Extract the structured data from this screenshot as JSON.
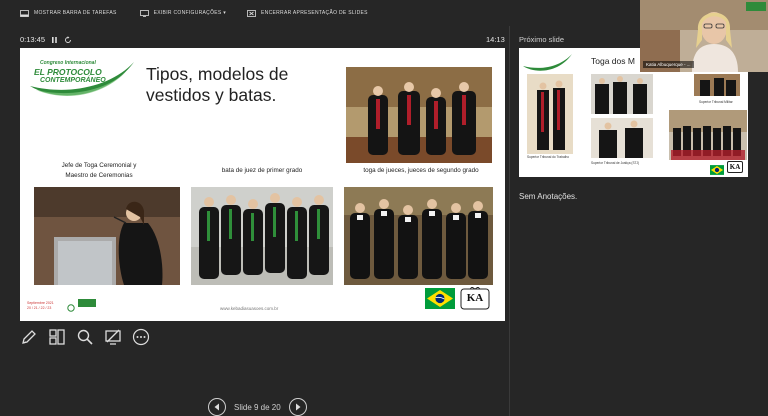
{
  "toolbar": {
    "show_taskbar": "MOSTRAR BARRA DE TAREFAS",
    "display_settings": "EXIBIR CONFIGURAÇÕES ▾",
    "end_show": "ENCERRAR APRESENTAÇÃO DE SLIDES"
  },
  "presenter": {
    "elapsed": "0:13:45",
    "clock": "14:13",
    "next_slide_label": "Próximo slide",
    "notes": "Sem Anotações.",
    "slide_counter": "Slide 9 de 20"
  },
  "slide": {
    "logo_line1": "Congreso Internacional",
    "logo_line2": "EL PROTOCOLO",
    "logo_line3": "CONTEMPORÁNEO",
    "title_line1": "Tipos, modelos de",
    "title_line2": "vestidos y batas.",
    "caption_1_line1": "Jefe de Toga Ceremonial y",
    "caption_1_line2": "Maestro de Ceremonias",
    "caption_2": "bata de juez de primer grado",
    "caption_3": "toga de jueces, jueces de segundo grado",
    "date_line1": "Septiembre 2021",
    "date_line2": "20 / 21 / 22 / 23",
    "website": "www.kebadiasuasoes.com.br",
    "ka_logo": "KA"
  },
  "next_slide": {
    "title": "Toga dos M",
    "cap_a": "Superior Tribunal do Trabalho",
    "cap_b": "Superior Tribunal de Justiça",
    "cap_b2": "(STJ)",
    "cap_c": "Superior Tribunal Militar",
    "ka_logo": "KA"
  },
  "video": {
    "name": "Katia Albuquerque - ..."
  },
  "colors": {
    "background": "#262626",
    "logo_green": "#2e8b3a",
    "brazil_green": "#009c3b",
    "brazil_yellow": "#ffdf00",
    "brazil_blue": "#002776"
  },
  "icons": [
    "taskbar-icon",
    "settings-icon",
    "end-show-icon",
    "pause-icon",
    "restart-icon",
    "pen-icon",
    "grid-icon",
    "zoom-icon",
    "screen-icon",
    "more-icon",
    "prev-icon",
    "next-icon"
  ]
}
